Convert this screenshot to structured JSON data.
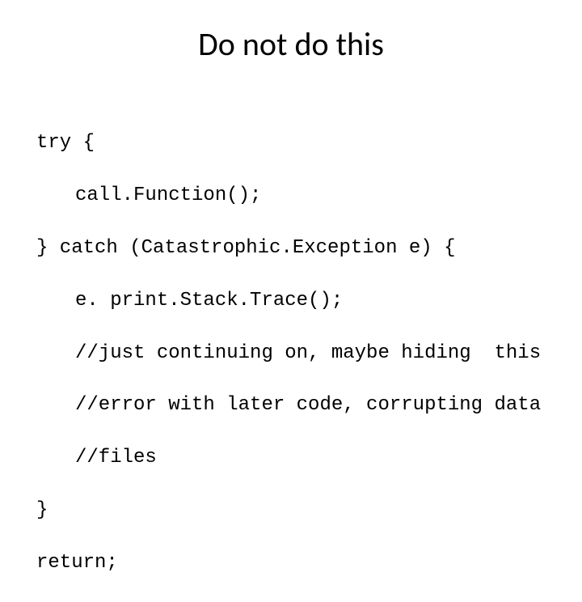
{
  "slide": {
    "title": "Do not do this",
    "code": {
      "line1": "try {",
      "line2": "call.Function();",
      "line3": "} catch (Catastrophic.Exception e) {",
      "line4": "e. print.Stack.Trace();",
      "line5": "//just continuing on, maybe hiding  this",
      "line6": "//error with later code, corrupting data",
      "line7": "//files",
      "line8": "}",
      "line9": "return;"
    }
  }
}
